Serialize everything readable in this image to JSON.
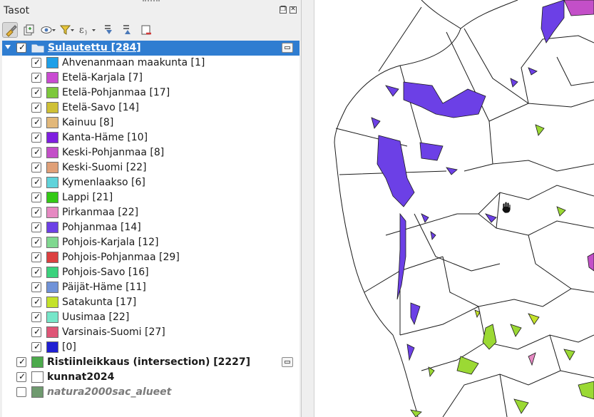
{
  "panel": {
    "title": "Tasot"
  },
  "toolbar": {
    "buttons": [
      {
        "icon": "style-paint-icon",
        "active": true
      },
      {
        "icon": "add-group-icon",
        "active": false
      },
      {
        "icon": "visibility-eye-icon",
        "active": false
      },
      {
        "icon": "filter-funnel-icon",
        "active": false
      },
      {
        "icon": "expression-filter-icon",
        "active": false
      },
      {
        "icon": "expand-all-icon",
        "active": false
      },
      {
        "icon": "collapse-all-icon",
        "active": false
      },
      {
        "icon": "remove-layer-icon",
        "active": false
      }
    ]
  },
  "layers": {
    "group": {
      "label": "Sulautettu [284]",
      "checked": true
    },
    "categories": [
      {
        "label": "Ahvenanmaan maakunta [1]",
        "color": "#1e9fe8",
        "checked": true
      },
      {
        "label": "Etelä-Karjala [7]",
        "color": "#c94bd2",
        "checked": true
      },
      {
        "label": "Etelä-Pohjanmaa [17]",
        "color": "#7dc83c",
        "checked": true
      },
      {
        "label": "Etelä-Savo [14]",
        "color": "#cfc035",
        "checked": true
      },
      {
        "label": "Kainuu [8]",
        "color": "#e2b87a",
        "checked": true
      },
      {
        "label": "Kanta-Häme [10]",
        "color": "#7f1fe0",
        "checked": true
      },
      {
        "label": "Keski-Pohjanmaa [8]",
        "color": "#c34fc8",
        "checked": true
      },
      {
        "label": "Keski-Suomi [22]",
        "color": "#e0a078",
        "checked": true
      },
      {
        "label": "Kymenlaakso [6]",
        "color": "#5fd3da",
        "checked": true
      },
      {
        "label": "Lappi [21]",
        "color": "#33c915",
        "checked": true
      },
      {
        "label": "Pirkanmaa [22]",
        "color": "#e689c2",
        "checked": true
      },
      {
        "label": "Pohjanmaa [14]",
        "color": "#6c40e6",
        "checked": true
      },
      {
        "label": "Pohjois-Karjala [12]",
        "color": "#80d890",
        "checked": true
      },
      {
        "label": "Pohjois-Pohjanmaa [29]",
        "color": "#dc4040",
        "checked": true
      },
      {
        "label": "Pohjois-Savo [16]",
        "color": "#3bd27d",
        "checked": true
      },
      {
        "label": "Päijät-Häme [11]",
        "color": "#7092d8",
        "checked": true
      },
      {
        "label": "Satakunta [17]",
        "color": "#c4e22a",
        "checked": true
      },
      {
        "label": "Uusimaa [22]",
        "color": "#76e6c9",
        "checked": true
      },
      {
        "label": "Varsinais-Suomi [27]",
        "color": "#df5577",
        "checked": true
      },
      {
        "label": " [0]",
        "color": "#1f1fd2",
        "checked": true
      }
    ],
    "others": [
      {
        "label": "Ristiinleikkaus (intersection) [2227]",
        "color": "#4caa4c",
        "checked": true,
        "style": "bold",
        "indicator": true
      },
      {
        "label": "kunnat2024",
        "color": "#ffffff",
        "checked": true,
        "style": "bold",
        "indicator": false
      },
      {
        "label": "natura2000sac_alueet",
        "color": "#6f9a6f",
        "checked": false,
        "style": "italic",
        "indicator": false
      }
    ]
  },
  "map": {
    "colors": {
      "pohjanmaa": "#6c40e6",
      "keski_pohjanmaa": "#c34fc8",
      "satakunta": "#c4e22a",
      "lappi": "#9bd934",
      "pirkanmaa": "#e689c2",
      "boundary": "#1a1a1a"
    }
  }
}
